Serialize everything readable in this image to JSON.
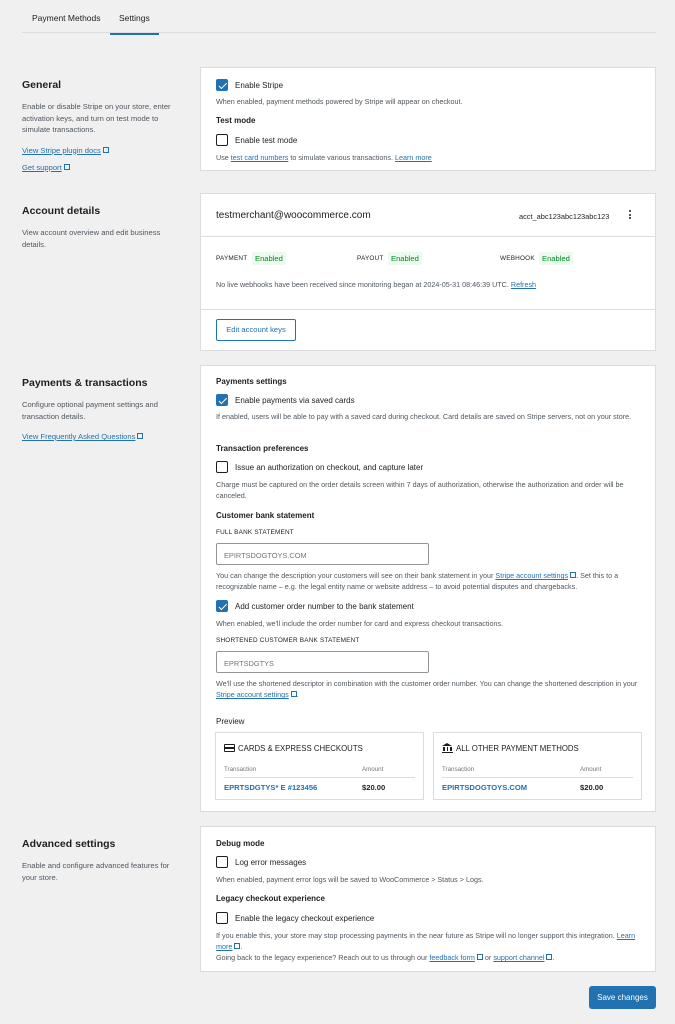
{
  "tabs": [
    {
      "label": "Payment Methods"
    },
    {
      "label": "Settings"
    }
  ],
  "general": {
    "title": "General",
    "desc": "Enable or disable Stripe on your store, enter activation keys, and turn on test mode to simulate transactions.",
    "link_docs": "View Stripe plugin docs",
    "link_support": "Get support",
    "enable_label": "Enable Stripe",
    "enable_help": "When enabled, payment methods powered by Stripe will appear on checkout.",
    "test_heading": "Test mode",
    "test_label": "Enable test mode",
    "test_help_pre": "Use",
    "test_help_link": "test card numbers",
    "test_help_mid": "to simulate various transactions.",
    "test_help_more": "Learn more"
  },
  "account": {
    "title": "Account details",
    "desc": "View account overview and edit business details.",
    "email": "testmerchant@woocommerce.com",
    "account_id": "acct_abc123abc123abc123",
    "payment_label": "PAYMENT",
    "payment_status": "Enabled",
    "payout_label": "PAYOUT",
    "payout_status": "Enabled",
    "webhook_label": "WEBHOOK",
    "webhook_status": "Enabled",
    "webhook_note": "No live webhooks have been received since monitoring began at 2024-05-31 08:46:39 UTC.",
    "refresh": "Refresh",
    "edit_keys": "Edit account keys"
  },
  "payments": {
    "title": "Payments & transactions",
    "desc": "Configure optional payment settings and transaction details.",
    "faq": "View Frequently Asked Questions",
    "settings_heading": "Payments settings",
    "saved_label": "Enable payments via saved cards",
    "saved_help": "If enabled, users will be able to pay with a saved card during checkout. Card details are saved on Stripe servers, not on your store.",
    "tx_heading": "Transaction preferences",
    "auth_label": "Issue an authorization on checkout, and capture later",
    "auth_help": "Charge must be captured on the order details screen within 7 days of authorization, otherwise the authorization and order will be canceled.",
    "bank_heading": "Customer bank statement",
    "full_caption": "FULL BANK STATEMENT",
    "full_value": "EPIRTSDOGTOYS.COM",
    "full_help_pre": "You can change the description your customers will see on their bank statement in your",
    "full_help_link": "Stripe account settings",
    "full_help_post": ". Set this to a recognizable name – e.g. the legal entity name or website address – to avoid potential disputes and chargebacks.",
    "order_label": "Add customer order number to the bank statement",
    "order_help": "When enabled, we'll include the order number for card and express checkout transactions.",
    "short_caption": "SHORTENED CUSTOMER BANK STATEMENT",
    "short_value": "EPRTSDGTYS",
    "short_help_pre": "We'll use the shortened descriptor in combination with the customer order number. You can change the shortened description in your",
    "short_help_link": "Stripe account settings",
    "short_help_post": ".",
    "preview_label": "Preview",
    "preview_cards": [
      {
        "title": "CARDS & EXPRESS CHECKOUTS",
        "col_tx": "Transaction",
        "col_amt": "Amount",
        "tx": "EPRTSDGTYS* E #123456",
        "amt": "$20.00"
      },
      {
        "title": "ALL OTHER PAYMENT METHODS",
        "col_tx": "Transaction",
        "col_amt": "Amount",
        "tx": "EPIRTSDOGTOYS.COM",
        "amt": "$20.00"
      }
    ]
  },
  "advanced": {
    "title": "Advanced settings",
    "desc": "Enable and configure advanced features for your store.",
    "debug_heading": "Debug mode",
    "log_label": "Log error messages",
    "log_help": "When enabled, payment error logs will be saved to WooCommerce > Status > Logs.",
    "legacy_heading": "Legacy checkout experience",
    "legacy_label": "Enable the legacy checkout experience",
    "legacy_help": "If you enable this, your store may stop processing payments in the near future as Stripe will no longer support this integration.",
    "legacy_more": "Learn more",
    "legacy_back_pre": "Going back to the legacy experience? Reach out to us through our",
    "legacy_feedback": "feedback form",
    "legacy_or": "or",
    "legacy_support": "support channel",
    "legacy_end": "."
  },
  "save_label": "Save changes",
  "colors": {
    "accent": "#2271b1",
    "success_bg": "#edfaef",
    "success_text": "#008a20"
  }
}
